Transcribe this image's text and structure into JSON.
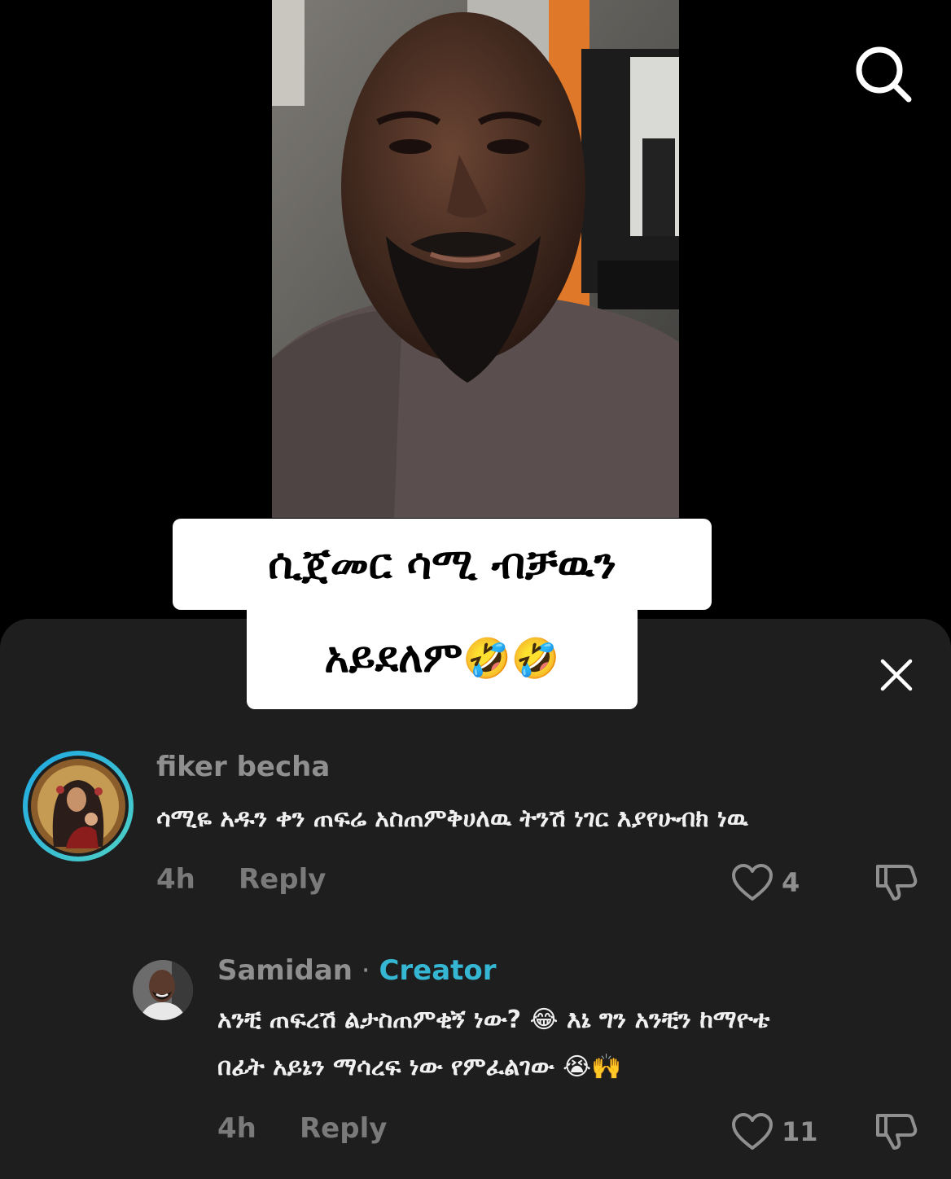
{
  "caption": {
    "line1": "ሲጀመር ሳሚ ብቻዉን",
    "line2": "አይደለም",
    "line2_emoji": "🤣🤣"
  },
  "comments": [
    {
      "username": "fiker becha",
      "text": "ሳሚዬ አዱን ቀን ጠፍሬ አስጠምቅሀለዉ ትንሽ ነገር እያየሁብክ ነዉ",
      "time": "4h",
      "reply_label": "Reply",
      "likes": "4"
    },
    {
      "username": "Samidan",
      "separator": " · ",
      "badge": "Creator",
      "text_line1": "አንቺ ጠፍረሽ ልታስጠምቂኝ ነው? 😂 እኔ ግን አንቺን ከማዮቴ",
      "text_line2": "በፊት አይኔን ማሳረፍ ነው የምፈልገው 😭🙌",
      "time": "4h",
      "reply_label": "Reply",
      "likes": "11"
    }
  ],
  "colors": {
    "creator_badge": "#35b7d3",
    "sheet_bg": "#1e1e1e",
    "avatar_ring": "#29a6d9"
  },
  "icons": {
    "search": "search-icon",
    "close": "close-icon",
    "like": "heart-icon",
    "dislike": "thumbs-down-icon"
  }
}
